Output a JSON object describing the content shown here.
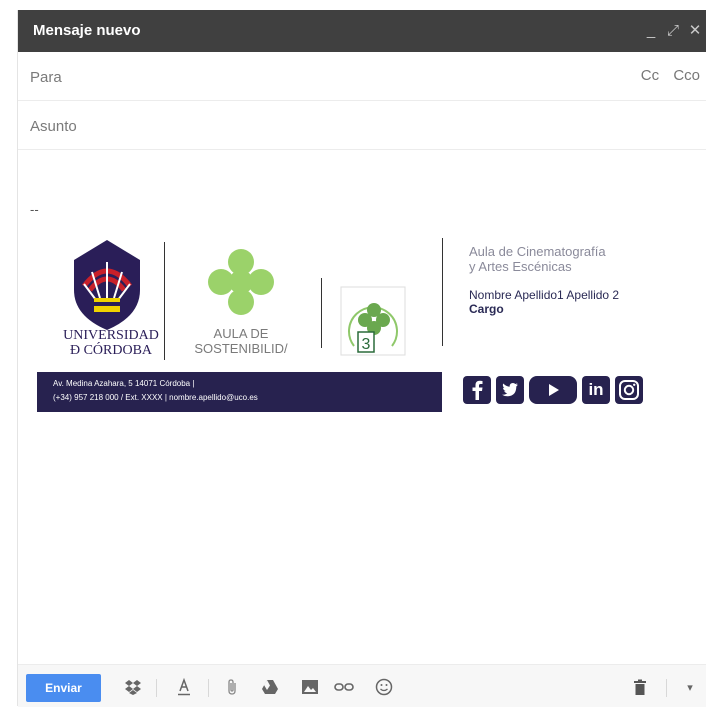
{
  "window": {
    "title": "Mensaje nuevo",
    "controls": {
      "minimize": "_",
      "expand": "⤢",
      "close": "✕"
    }
  },
  "fields": {
    "to_placeholder": "Para",
    "cc_label": "Cc",
    "cco_label": "Cco",
    "subject_placeholder": "Asunto"
  },
  "body": {
    "signature_separator": "--"
  },
  "signature": {
    "university_line1": "UNIVERSIDAD",
    "university_line2": "Ð CÓRDOBA",
    "aula_line1": "AULA DE",
    "aula_line2": "SOSTENIBILID/",
    "badge_number": "3",
    "dept_line1": "Aula de Cinematografía",
    "dept_line2": "y Artes Escénicas",
    "person_name": "Nombre Apellido1 Apellido 2",
    "person_role": "Cargo",
    "address_line1": "Av. Medina Azahara, 5 14071 Córdoba |",
    "address_line2": "(+34) 957 218 000 / Ext. XXXX | nombre.apellido@uco.es",
    "social_linkedin": "in"
  },
  "toolbar": {
    "send_label": "Enviar",
    "more_label": "▾"
  },
  "colors": {
    "titlebar": "#404040",
    "brand_navy": "#27224f",
    "send_blue": "#4a8df0",
    "clover_green": "#9bd26a"
  }
}
